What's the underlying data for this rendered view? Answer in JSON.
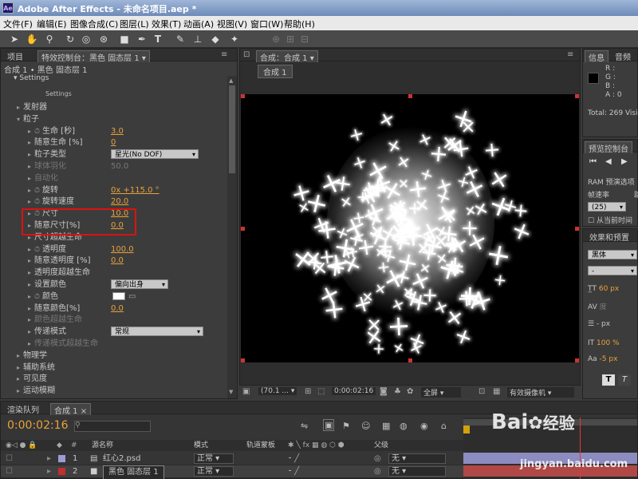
{
  "app": {
    "title": "Adobe After Effects - 未命名项目.aep *",
    "logo": "Ae"
  },
  "menu": [
    "文件(F)",
    "编辑(E)",
    "图像合成(C)",
    "图层(L)",
    "效果(T)",
    "动画(A)",
    "视图(V)",
    "窗口(W)",
    "帮助(H)"
  ],
  "tools": [
    "selection-tool",
    "hand-tool",
    "zoom-tool",
    "rotate-tool",
    "orbit-camera-tool",
    "pan-behind-tool",
    "rectangle-tool",
    "pen-tool",
    "text-tool",
    "brush-tool",
    "clone-stamp-tool",
    "eraser-tool",
    "puppet-tool"
  ],
  "left_panel": {
    "tab_project": "项目",
    "tab_effects": "特效控制台：黑色 固态层 1",
    "breadcrumb": "合成 1 • 黑色 固态层 1",
    "settings_label": "Settings",
    "settings_button": "Settings",
    "rows": [
      {
        "label": "发射器",
        "indent": 1,
        "tri": true
      },
      {
        "label": "粒子",
        "indent": 1,
        "tri": true,
        "open": true
      },
      {
        "label": "生命 [秒]",
        "indent": 3,
        "sw": true,
        "value": "3.0"
      },
      {
        "label": "随意生命 [%]",
        "indent": 3,
        "value": "0"
      },
      {
        "label": "粒子类型",
        "indent": 3,
        "dropdown": "星光(No DOF)"
      },
      {
        "label": "球体羽化",
        "indent": 3,
        "value": "50.0",
        "dim": true
      },
      {
        "label": "自动化",
        "indent": 3,
        "dim": true
      },
      {
        "label": "旋转",
        "indent": 3,
        "sw": true,
        "value": "0x +115.0 °"
      },
      {
        "label": "旋转速度",
        "indent": 3,
        "sw": true,
        "value": "20.0"
      },
      {
        "label": "尺寸",
        "indent": 3,
        "sw": true,
        "value": "10.0"
      },
      {
        "label": "随意尺寸[%]",
        "indent": 3,
        "value": "0.0"
      },
      {
        "label": "尺寸超越生命",
        "indent": 3,
        "tri": true
      },
      {
        "label": "透明度",
        "indent": 3,
        "sw": true,
        "value": "100.0"
      },
      {
        "label": "随意透明度 [%]",
        "indent": 3,
        "value": "0.0"
      },
      {
        "label": "透明度超越生命",
        "indent": 3,
        "tri": true
      },
      {
        "label": "设置颜色",
        "indent": 3,
        "dropdown": "偏向出身"
      },
      {
        "label": "颜色",
        "indent": 3,
        "sw": true,
        "color": true
      },
      {
        "label": "随意颜色[%]",
        "indent": 3,
        "value": "0.0"
      },
      {
        "label": "颜色超越生命",
        "indent": 3,
        "dim": true
      },
      {
        "label": "传递模式",
        "indent": 3,
        "dropdown": "常规"
      },
      {
        "label": "传递模式超越生命",
        "indent": 3,
        "dim": true
      },
      {
        "label": "物理学",
        "indent": 1,
        "tri": true
      },
      {
        "label": "辅助系统",
        "indent": 1,
        "tri": true
      },
      {
        "label": "可见度",
        "indent": 1,
        "tri": true
      },
      {
        "label": "运动模糊",
        "indent": 1,
        "tri": true
      }
    ]
  },
  "comp": {
    "tab": "合成：合成 1",
    "sub_tab": "合成 1",
    "zoom": "(70.1 ...",
    "timecode": "0:00:02:16",
    "resolution": "全屏",
    "camera": "有效摄像机"
  },
  "info": {
    "tab": "信息",
    "tab2": "音频",
    "r": "R :",
    "g": "G :",
    "b": "B :",
    "a": "A : 0",
    "total": "Total: 269",
    "visi": "Visi"
  },
  "preview": {
    "tab": "预览控制台",
    "ram": "RAM 预演选项",
    "frame_rate_label": "帧速率",
    "skip_label": "跳",
    "frame_rate": "(25)",
    "from_current": "从当前时间"
  },
  "effects_preset": {
    "tab": "效果和预置",
    "font": "黑体",
    "font_style": "-",
    "font_size": "60 px",
    "tracking": "度",
    "line_spacing": "- px",
    "scale": "100 %",
    "baseline": "-5 px"
  },
  "timeline": {
    "tab_render": "渲染队列",
    "tab_comp": "合成 1",
    "timecode": "0:00:02:16",
    "col_name": "源名称",
    "col_mode": "模式",
    "col_trkmat": "轨道蒙板",
    "col_parent": "父级",
    "layers": [
      {
        "num": "1",
        "name": "红心2.psd",
        "mode": "正常",
        "color": "#9c9cd8",
        "parent": "无"
      },
      {
        "num": "2",
        "name": "黑色 固态层 1",
        "mode": "正常",
        "color": "#c03030",
        "parent": "无"
      }
    ],
    "trkmat_none": "无"
  },
  "watermark": {
    "brand": "Bai",
    "brand2": "经验",
    "url": "jingyan.baidu.com"
  },
  "colors": {
    "accent": "#e8a23c",
    "highlight_box": "#dd1111"
  }
}
